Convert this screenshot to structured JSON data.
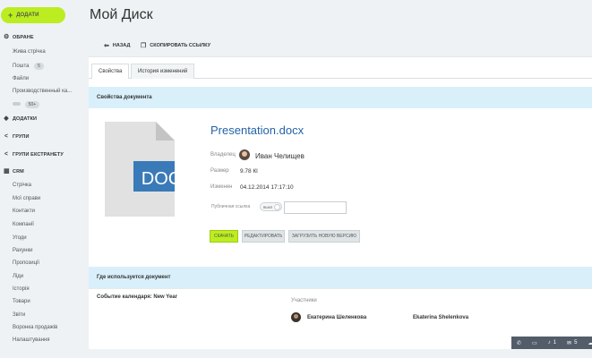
{
  "sidebar": {
    "add_label": "ДОДАТИ",
    "favorites": "ОБРАНЕ",
    "favorites_items": [
      "Жива стрічка",
      "Пошта",
      "Файли",
      "Производственный ка..."
    ],
    "mail_badge": "5",
    "counter_badge": "50+",
    "apps": "ДОДАТКИ",
    "groups": "ГРУПИ",
    "extranet": "ГРУПИ ЕКСТРАНЕТУ",
    "crm": "CRM",
    "crm_items": [
      "Стрічка",
      "Мої справи",
      "Контакти",
      "Компанії",
      "Угоди",
      "Рахунки",
      "Пропозиції",
      "Ліди",
      "Історія",
      "Товари",
      "Звіти",
      "Воронка продажів",
      "Налаштування"
    ]
  },
  "page": {
    "title": "Мой Диск"
  },
  "toolbar": {
    "back": "НАЗАД",
    "copy_link": "СКОПИРОВАТЬ ССЫЛКУ"
  },
  "tabs": [
    "Свойства",
    "История изменений"
  ],
  "properties": {
    "section_title": "Свойства документа",
    "doc_badge": "DOC",
    "file_name": "Presentation.docx",
    "owner_label": "Владелец",
    "owner_name": "Иван Челищев",
    "size_label": "Размер",
    "size_value": "9.78 Кl",
    "modified_label": "Изменен",
    "modified_value": "04.12.2014 17:17:10",
    "public_link_label": "Публичная ссылка",
    "toggle_label": "выкл"
  },
  "buttons": {
    "download": "СКАЧАТЬ",
    "edit": "РЕДАКТИРОВАТЬ",
    "upload": "ЗАГРУЗИТЬ НОВУЮ ВЕРСИЮ"
  },
  "usage": {
    "section_title": "Где используется документ",
    "event": "Событие календаря: New Year",
    "participants_label": "Участники",
    "participants": [
      "Екатерина Шеленкова",
      "Ekaterina Shelenkova"
    ]
  },
  "statusbar": {
    "notifications": "1",
    "messages": "5"
  },
  "colors": {
    "accent": "#bbed21",
    "link": "#2463a8",
    "doc_blue": "#3a7ab8",
    "section_bar": "#d9f0fb"
  }
}
